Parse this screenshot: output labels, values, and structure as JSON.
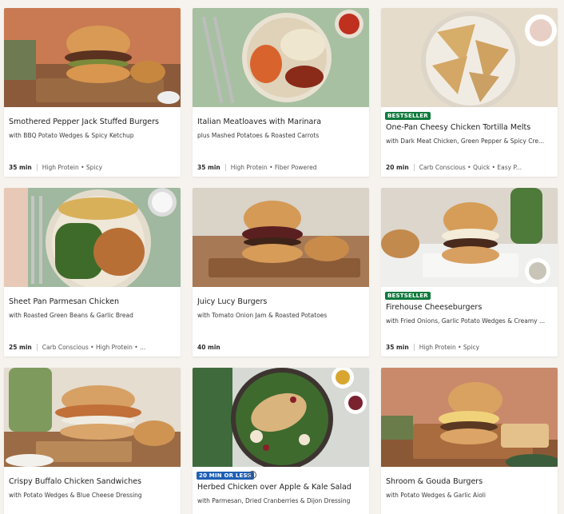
{
  "recipes": [
    {
      "title": "Smothered Pepper Jack Stuffed Burgers",
      "subtitle": "with BBQ Potato Wedges & Spicy Ketchup",
      "time": "35 min",
      "tags": "High Protein • Spicy",
      "badge": "",
      "photo_bg": "#c97a52"
    },
    {
      "title": "Italian Meatloaves with Marinara",
      "subtitle": "plus Mashed Potatoes & Roasted Carrots",
      "time": "35 min",
      "tags": "High Protein • Fiber Powered",
      "badge": "",
      "photo_bg": "#a7c0a1"
    },
    {
      "title": "One-Pan Cheesy Chicken Tortilla Melts",
      "subtitle": "with Dark Meat Chicken, Green Pepper & Spicy Cre...",
      "time": "20 min",
      "tags": "Carb Conscious • Quick • Easy P...",
      "badge": "BESTSELLER",
      "photo_bg": "#e6dccb"
    },
    {
      "title": "Sheet Pan Parmesan Chicken",
      "subtitle": "with Roasted Green Beans & Garlic Bread",
      "time": "25 min",
      "tags": "Carb Conscious • High Protein • ...",
      "badge": "",
      "photo_bg": "#9fb89f"
    },
    {
      "title": "Juicy Lucy Burgers",
      "subtitle": "with Tomato Onion Jam & Roasted Potatoes",
      "time": "40 min",
      "tags": "",
      "badge": "",
      "photo_bg": "#d9d3c8"
    },
    {
      "title": "Firehouse Cheeseburgers",
      "subtitle": "with Fried Onions, Garlic Potato Wedges & Creamy ...",
      "time": "35 min",
      "tags": "High Protein • Spicy",
      "badge": "BESTSELLER",
      "photo_bg": "#dcd6cc"
    },
    {
      "title": "Crispy Buffalo Chicken Sandwiches",
      "subtitle": "with Potato Wedges & Blue Cheese Dressing",
      "time": "",
      "tags": "",
      "badge": "",
      "photo_bg": "#e4ddd0"
    },
    {
      "title": "Herbed Chicken over Apple & Kale Salad",
      "subtitle": "with Parmesan, Dried Cranberries & Dijon Dressing",
      "time": "",
      "tags": "",
      "badge": "20 MIN OR LESS",
      "photo_bg": "#d6d9d4"
    },
    {
      "title": "Shroom & Gouda Burgers",
      "subtitle": "with Potato Wedges & Garlic Aioli",
      "time": "",
      "tags": "",
      "badge": "",
      "photo_bg": "#c98a6c"
    }
  ],
  "colors": {
    "bestseller": "#0e7a3c",
    "fast_badge": "#1e5fb4"
  }
}
